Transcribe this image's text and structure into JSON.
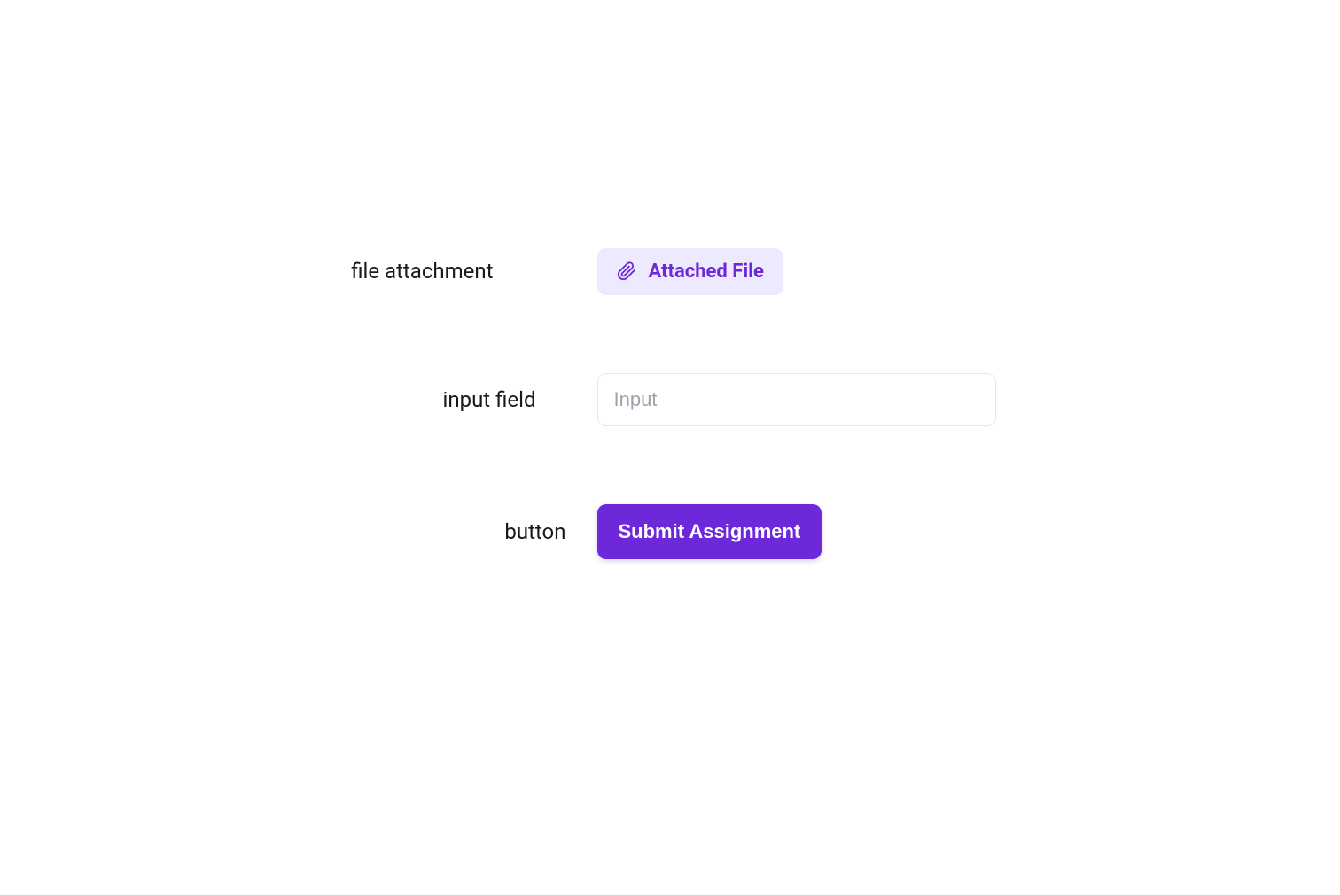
{
  "rows": {
    "attachment": {
      "label": "file attachment",
      "chip_text": "Attached File"
    },
    "input": {
      "label": "input field",
      "placeholder": "Input",
      "value": ""
    },
    "button": {
      "label": "button",
      "button_text": "Submit Assignment"
    }
  },
  "colors": {
    "accent": "#6d28d9",
    "accent_light": "#ede9fe",
    "border": "#e5e7eb",
    "placeholder": "#9ca3af",
    "text": "#1a1a1a"
  }
}
